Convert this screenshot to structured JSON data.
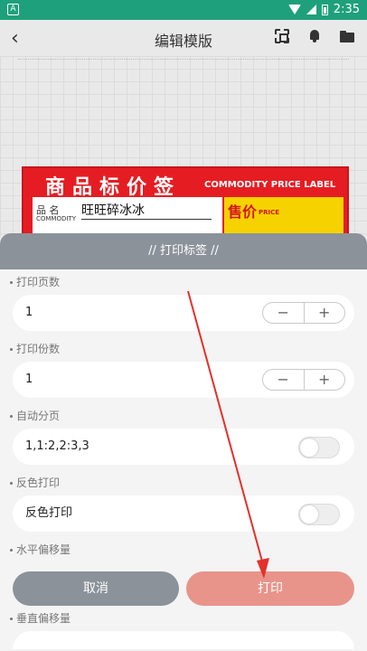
{
  "statusbar": {
    "icon_letter": "A",
    "time": "2:35"
  },
  "appbar": {
    "back_glyph": "‹",
    "title": "编辑模版"
  },
  "label_preview": {
    "title": "商品标价签",
    "subtitle": "COMMODITY PRICE LABEL",
    "name_key": "品  名",
    "name_sub": "COMMODITY",
    "name_value": "旺旺碎冰冰",
    "price_key": "售价",
    "price_sub": "PRICE",
    "colors": {
      "red": "#e51d22",
      "yellow": "#f5d200"
    }
  },
  "sheet": {
    "title": "// 打印标签 //",
    "sections": [
      {
        "label": "打印页数",
        "value": "1",
        "control": "stepper",
        "minus": "−",
        "plus": "+"
      },
      {
        "label": "打印份数",
        "value": "1",
        "control": "stepper",
        "minus": "−",
        "plus": "+"
      },
      {
        "label": "自动分页",
        "value": "1,1:2,2:3,3",
        "control": "toggle"
      },
      {
        "label": "反色打印",
        "value": "反色打印",
        "control": "toggle"
      },
      {
        "label": "水平偏移量"
      },
      {
        "label": "垂直偏移量"
      }
    ]
  },
  "buttons": {
    "cancel": "取消",
    "print": "打印"
  },
  "colors": {
    "statusbar": "#1fa07c",
    "sheet_header": "#8b9299",
    "print_button": "#e8948b",
    "arrow": "#e4312b"
  }
}
